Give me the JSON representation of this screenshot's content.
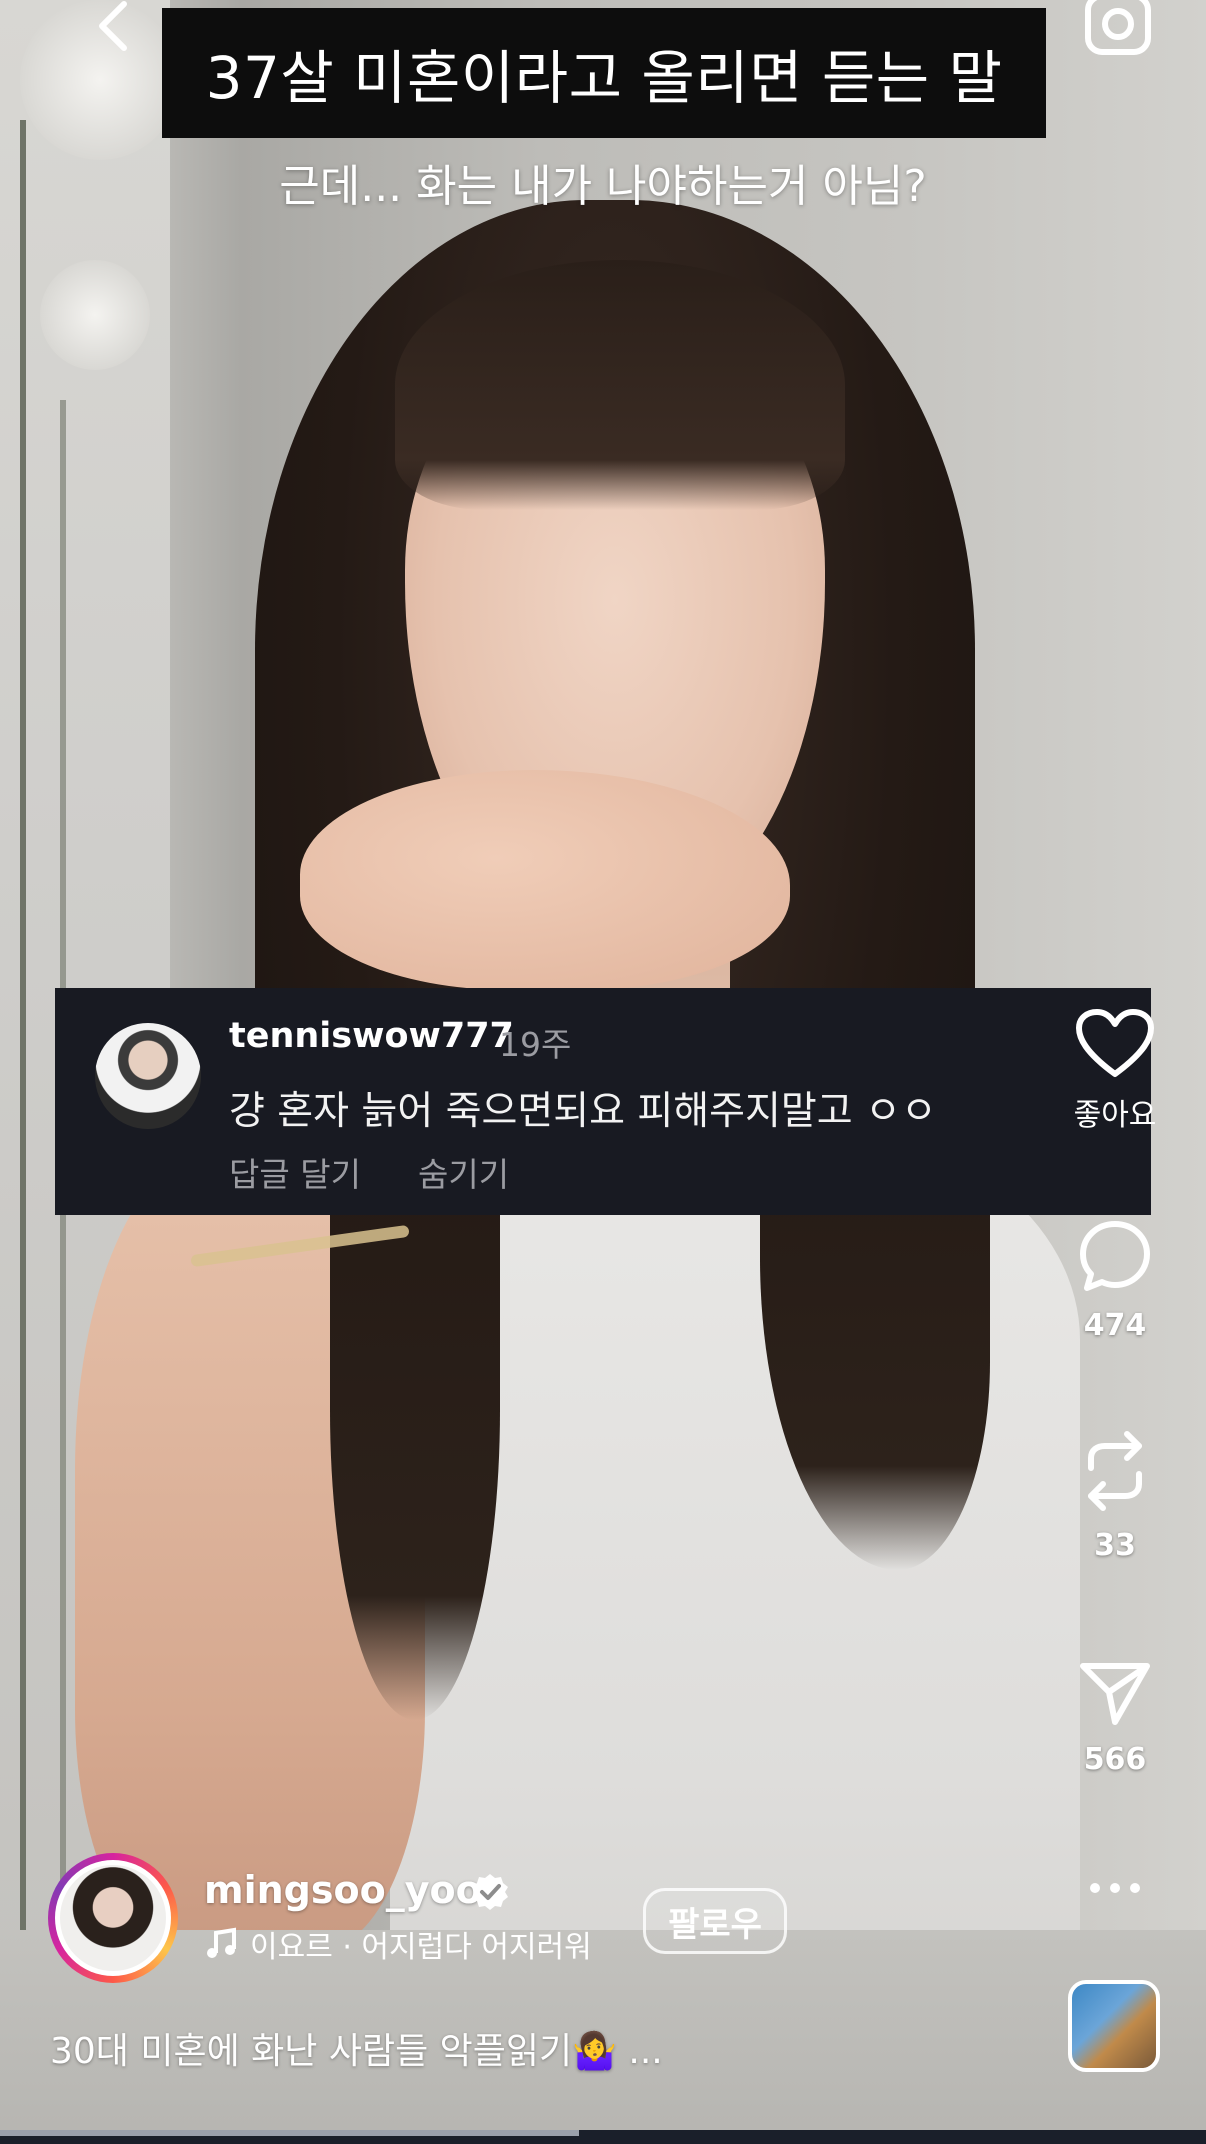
{
  "overlay": {
    "title": "37살 미혼이라고 올리면 듣는 말",
    "subtitle": "근데... 화는 내가 나야하는거 아님?"
  },
  "comment": {
    "username": "tenniswow777",
    "time": "19주",
    "text": "걍 혼자 늙어 죽으면되요 피해주지말고 ㅇㅇ",
    "reply_label": "답글 달기",
    "hide_label": "숨기기"
  },
  "actions": {
    "like_label": "좋아요",
    "comments_count": "474",
    "reposts_count": "33",
    "shares_count": "566"
  },
  "author": {
    "username": "mingsoo_yoo",
    "verified": true,
    "follow_label": "팔로우",
    "music": "이요르 · 어지럽다 어지러워"
  },
  "caption": {
    "text": "30대 미혼에 화난 사람들 악플읽기🤷‍♀️",
    "more": "..."
  },
  "video": {
    "progress": 0.48
  },
  "colors": {
    "comment_bg": "#181a22",
    "title_bg": "#0d0d0d",
    "muted_text": "#9b9ca2",
    "verified_badge": "#ffffff"
  },
  "icons": {
    "back": "chevron-left-icon",
    "camera": "camera-icon",
    "like": "heart-icon",
    "comment": "comment-bubble-icon",
    "repost": "repost-icon",
    "share": "paper-plane-icon",
    "more": "more-horizontal-icon",
    "music": "music-note-icon",
    "verified": "verified-badge-icon"
  }
}
